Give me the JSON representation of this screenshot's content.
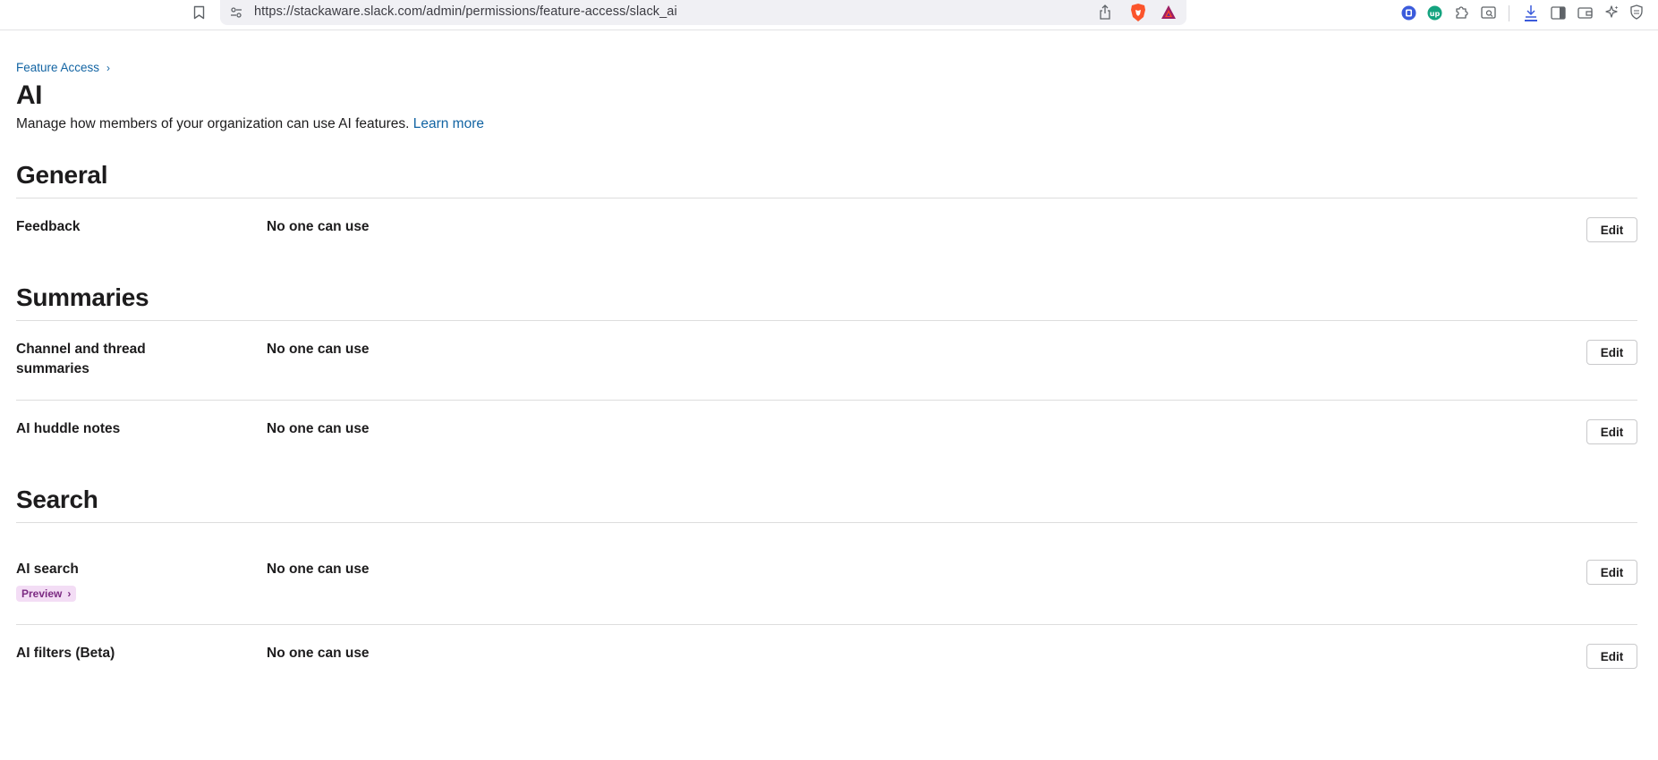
{
  "browser": {
    "url": "https://stackaware.slack.com/admin/permissions/feature-access/slack_ai"
  },
  "breadcrumb": {
    "parent": "Feature Access"
  },
  "page": {
    "title": "AI",
    "description": "Manage how members of your organization can use AI features.",
    "learn_more": "Learn more"
  },
  "sections": [
    {
      "title": "General",
      "rows": [
        {
          "label": "Feedback",
          "value": "No one can use",
          "action": "Edit"
        }
      ]
    },
    {
      "title": "Summaries",
      "rows": [
        {
          "label": "Channel and thread summaries",
          "value": "No one can use",
          "action": "Edit"
        },
        {
          "label": "AI huddle notes",
          "value": "No one can use",
          "action": "Edit"
        }
      ]
    },
    {
      "title": "Search",
      "rows": [
        {
          "label": "AI search",
          "badge": "Preview",
          "value": "No one can use",
          "action": "Edit"
        },
        {
          "label": "AI filters (Beta)",
          "value": "No one can use",
          "action": "Edit"
        }
      ]
    }
  ],
  "colors": {
    "link": "#1264a3",
    "badge_bg": "#f3ddf5",
    "badge_text": "#7c2b83",
    "brave": "#fb542b"
  },
  "icons": [
    "bookmark-icon",
    "site-settings-icon",
    "share-icon",
    "brave-shields-icon",
    "brave-rewards-icon",
    "extension-icon",
    "puzzle-icon",
    "download-icon",
    "sidebar-icon",
    "wallet-icon",
    "leo-ai-icon",
    "vpn-icon"
  ]
}
